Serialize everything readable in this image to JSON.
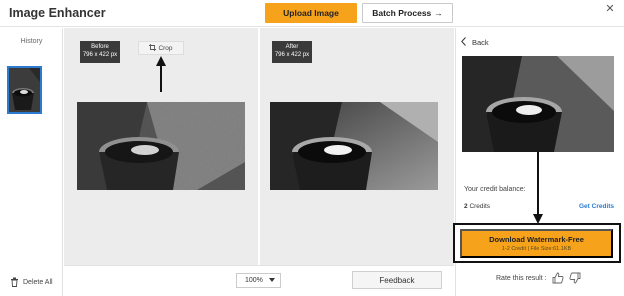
{
  "header": {
    "app_title": "Image Enhancer",
    "upload_label": "Upload Image",
    "batch_label": "Batch Process",
    "batch_arrow": "→",
    "close_glyph": "✕"
  },
  "history": {
    "label": "History",
    "delete_all_label": "Delete All"
  },
  "workspace": {
    "before_label": "Before",
    "before_size": "796 x 422 px",
    "after_label": "After",
    "after_size": "796 x 422 px",
    "crop_label": "Crop",
    "zoom_value": "100%",
    "feedback_label": "Feedback"
  },
  "right_panel": {
    "back_label": "Back",
    "credit_balance_label": "Your credit balance:",
    "credit_count": "2",
    "credit_unit": "Credits",
    "get_credits_label": "Get Credits",
    "download_title": "Download Watermark-Free",
    "download_sub": "1-2 Credit | File Size:61.1KB",
    "rate_label": "Rate this result :"
  },
  "colors": {
    "accent_orange": "#f7a21b",
    "link_blue": "#2d7bd0",
    "selected_border": "#2d7bd0"
  },
  "icons": [
    "close-icon",
    "crop-icon",
    "arrow-up-icon",
    "trash-icon",
    "chevron-down-icon",
    "back-chevron-icon",
    "arrow-down-icon",
    "thumbs-up-icon",
    "thumbs-down-icon"
  ]
}
